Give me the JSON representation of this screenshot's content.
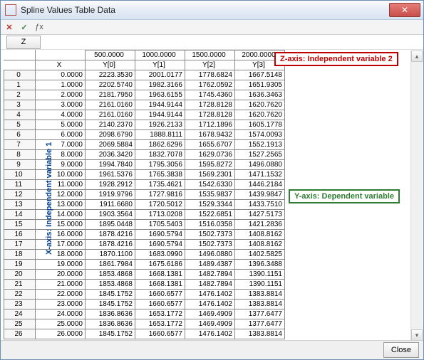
{
  "window": {
    "title": "Spline Values Table Data"
  },
  "toolbar": {
    "z_label": "Z",
    "delete_icon": "✕",
    "check_icon": "✓",
    "fx_icon": "ƒx"
  },
  "headers": {
    "x_label": "X",
    "z_values": [
      "500.0000",
      "1000.0000",
      "1500.0000",
      "2000.0000"
    ],
    "y_labels": [
      "Y[0]",
      "Y[1]",
      "Y[2]",
      "Y[3]"
    ]
  },
  "annotations": {
    "z": "Z-axis: Independent variable 2",
    "y": "Y-axis: Dependent variable",
    "x": "X-axis: Independent variable 1"
  },
  "footer": {
    "close": "Close"
  },
  "rows": [
    {
      "i": 0,
      "x": "0.0000",
      "y": [
        "2223.3530",
        "2001.0177",
        "1778.6824",
        "1667.5148"
      ]
    },
    {
      "i": 1,
      "x": "1.0000",
      "y": [
        "2202.5740",
        "1982.3166",
        "1762.0592",
        "1651.9305"
      ]
    },
    {
      "i": 2,
      "x": "2.0000",
      "y": [
        "2181.7950",
        "1963.6155",
        "1745.4360",
        "1636.3463"
      ]
    },
    {
      "i": 3,
      "x": "3.0000",
      "y": [
        "2161.0160",
        "1944.9144",
        "1728.8128",
        "1620.7620"
      ]
    },
    {
      "i": 4,
      "x": "4.0000",
      "y": [
        "2161.0160",
        "1944.9144",
        "1728.8128",
        "1620.7620"
      ]
    },
    {
      "i": 5,
      "x": "5.0000",
      "y": [
        "2140.2370",
        "1926.2133",
        "1712.1896",
        "1605.1778"
      ]
    },
    {
      "i": 6,
      "x": "6.0000",
      "y": [
        "2098.6790",
        "1888.8111",
        "1678.9432",
        "1574.0093"
      ]
    },
    {
      "i": 7,
      "x": "7.0000",
      "y": [
        "2069.5884",
        "1862.6296",
        "1655.6707",
        "1552.1913"
      ]
    },
    {
      "i": 8,
      "x": "8.0000",
      "y": [
        "2036.3420",
        "1832.7078",
        "1629.0736",
        "1527.2565"
      ]
    },
    {
      "i": 9,
      "x": "9.0000",
      "y": [
        "1994.7840",
        "1795.3056",
        "1595.8272",
        "1496.0880"
      ]
    },
    {
      "i": 10,
      "x": "10.0000",
      "y": [
        "1961.5376",
        "1765.3838",
        "1569.2301",
        "1471.1532"
      ]
    },
    {
      "i": 11,
      "x": "11.0000",
      "y": [
        "1928.2912",
        "1735.4621",
        "1542.6330",
        "1446.2184"
      ]
    },
    {
      "i": 12,
      "x": "12.0000",
      "y": [
        "1919.9796",
        "1727.9816",
        "1535.9837",
        "1439.9847"
      ]
    },
    {
      "i": 13,
      "x": "13.0000",
      "y": [
        "1911.6680",
        "1720.5012",
        "1529.3344",
        "1433.7510"
      ]
    },
    {
      "i": 14,
      "x": "14.0000",
      "y": [
        "1903.3564",
        "1713.0208",
        "1522.6851",
        "1427.5173"
      ]
    },
    {
      "i": 15,
      "x": "15.0000",
      "y": [
        "1895.0448",
        "1705.5403",
        "1516.0358",
        "1421.2836"
      ]
    },
    {
      "i": 16,
      "x": "16.0000",
      "y": [
        "1878.4216",
        "1690.5794",
        "1502.7373",
        "1408.8162"
      ]
    },
    {
      "i": 17,
      "x": "17.0000",
      "y": [
        "1878.4216",
        "1690.5794",
        "1502.7373",
        "1408.8162"
      ]
    },
    {
      "i": 18,
      "x": "18.0000",
      "y": [
        "1870.1100",
        "1683.0990",
        "1496.0880",
        "1402.5825"
      ]
    },
    {
      "i": 19,
      "x": "19.0000",
      "y": [
        "1861.7984",
        "1675.6186",
        "1489.4387",
        "1396.3488"
      ]
    },
    {
      "i": 20,
      "x": "20.0000",
      "y": [
        "1853.4868",
        "1668.1381",
        "1482.7894",
        "1390.1151"
      ]
    },
    {
      "i": 21,
      "x": "21.0000",
      "y": [
        "1853.4868",
        "1668.1381",
        "1482.7894",
        "1390.1151"
      ]
    },
    {
      "i": 22,
      "x": "22.0000",
      "y": [
        "1845.1752",
        "1660.6577",
        "1476.1402",
        "1383.8814"
      ]
    },
    {
      "i": 23,
      "x": "23.0000",
      "y": [
        "1845.1752",
        "1660.6577",
        "1476.1402",
        "1383.8814"
      ]
    },
    {
      "i": 24,
      "x": "24.0000",
      "y": [
        "1836.8636",
        "1653.1772",
        "1469.4909",
        "1377.6477"
      ]
    },
    {
      "i": 25,
      "x": "25.0000",
      "y": [
        "1836.8636",
        "1653.1772",
        "1469.4909",
        "1377.6477"
      ]
    },
    {
      "i": 26,
      "x": "26.0000",
      "y": [
        "1845.1752",
        "1660.6577",
        "1476.1402",
        "1383.8814"
      ]
    }
  ]
}
